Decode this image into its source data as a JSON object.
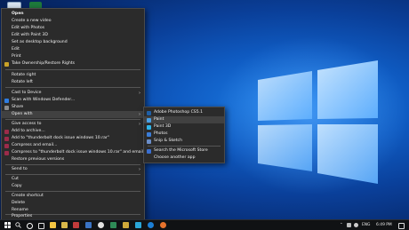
{
  "menu": {
    "items": [
      {
        "label": "Open",
        "bold": true
      },
      {
        "label": "Create a new video"
      },
      {
        "label": "Edit with Photos"
      },
      {
        "label": "Edit with Paint 3D"
      },
      {
        "label": "Set as desktop background"
      },
      {
        "label": "Edit"
      },
      {
        "label": "Print"
      },
      {
        "label": "Take Ownership/Restore Rights"
      },
      {
        "label": "Rotate right"
      },
      {
        "label": "Rotate left"
      },
      {
        "label": "Cast to Device"
      },
      {
        "label": "Scan with Windows Defender..."
      },
      {
        "label": "Share"
      },
      {
        "label": "Open with"
      },
      {
        "label": "Give access to"
      },
      {
        "label": "Add to archive..."
      },
      {
        "label": "Add to \"thunderbolt dock issue windows 10.rar\""
      },
      {
        "label": "Compress and email..."
      },
      {
        "label": "Compress to \"thunderbolt dock issue windows 10.rar\" and email"
      },
      {
        "label": "Restore previous versions"
      },
      {
        "label": "Send to"
      },
      {
        "label": "Cut"
      },
      {
        "label": "Copy"
      },
      {
        "label": "Create shortcut"
      },
      {
        "label": "Delete"
      },
      {
        "label": "Rename"
      },
      {
        "label": "Properties"
      }
    ]
  },
  "submenu": {
    "items": [
      {
        "label": "Adobe Photoshop CS5.1"
      },
      {
        "label": "Paint"
      },
      {
        "label": "Paint 3D"
      },
      {
        "label": "Photos"
      },
      {
        "label": "Snip & Sketch"
      },
      {
        "label": "Search the Microsoft Store"
      },
      {
        "label": "Choose another app"
      }
    ]
  },
  "taskbar": {
    "language": "ENG",
    "time": "6:49 PM"
  },
  "icons": {
    "submenu_arrow": "chevron-right-icon",
    "start": "windows-start-icon",
    "search": "search-icon"
  },
  "colors": {
    "menu_bg": "#2b2b2b",
    "menu_highlight": "#414141",
    "desktop_blue": "#0f5bc2",
    "taskbar": "#101214"
  }
}
